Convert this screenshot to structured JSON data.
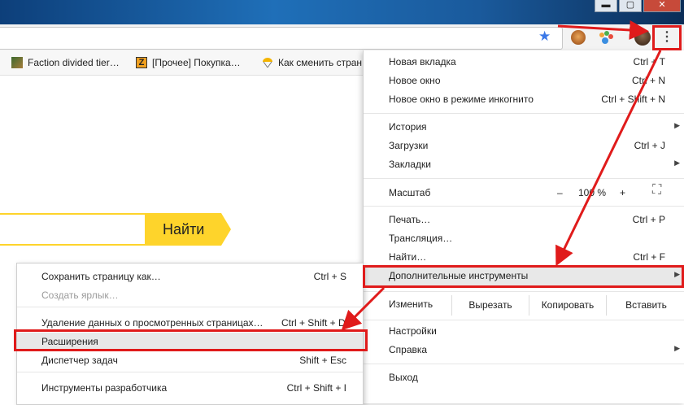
{
  "window": {
    "minimize": "▬",
    "maximize": "▢",
    "close": "✕"
  },
  "toolbar": {
    "bookmark_star": "★",
    "menu_icon": "⋮"
  },
  "bookmarks": [
    {
      "label": "Faction divided tier…"
    },
    {
      "label": "[Прочее] Покупка…",
      "icon_letter": "Z"
    },
    {
      "label": "Как сменить стран"
    }
  ],
  "search": {
    "button_label": "Найти"
  },
  "menu": {
    "new_tab": {
      "label": "Новая вкладка",
      "shortcut": "Ctrl + T"
    },
    "new_window": {
      "label": "Новое окно",
      "shortcut": "Ctrl + N"
    },
    "incognito": {
      "label": "Новое окно в режиме инкогнито",
      "shortcut": "Ctrl + Shift + N"
    },
    "history": {
      "label": "История"
    },
    "downloads": {
      "label": "Загрузки",
      "shortcut": "Ctrl + J"
    },
    "bookmarks": {
      "label": "Закладки"
    },
    "zoom": {
      "label": "Масштаб",
      "minus": "–",
      "value": "100 %",
      "plus": "+",
      "fullscreen": "⛶"
    },
    "print": {
      "label": "Печать…",
      "shortcut": "Ctrl + P"
    },
    "cast": {
      "label": "Трансляция…"
    },
    "find": {
      "label": "Найти…",
      "shortcut": "Ctrl + F"
    },
    "more_tools": {
      "label": "Дополнительные инструменты"
    },
    "edit": {
      "label": "Изменить",
      "cut": "Вырезать",
      "copy": "Копировать",
      "paste": "Вставить"
    },
    "settings": {
      "label": "Настройки"
    },
    "help": {
      "label": "Справка"
    },
    "exit": {
      "label": "Выход"
    },
    "arrow": "▶"
  },
  "submenu": {
    "save_page": {
      "label": "Сохранить страницу как…",
      "shortcut": "Ctrl + S"
    },
    "create_shortcut": {
      "label": "Создать ярлык…"
    },
    "clear_data": {
      "label": "Удаление данных о просмотренных страницах…",
      "shortcut": "Ctrl + Shift + Del"
    },
    "extensions": {
      "label": "Расширения"
    },
    "task_manager": {
      "label": "Диспетчер задач",
      "shortcut": "Shift + Esc"
    },
    "dev_tools": {
      "label": "Инструменты разработчика",
      "shortcut": "Ctrl + Shift + I"
    }
  },
  "colors": {
    "highlight_red": "#e01b1b",
    "yandex_yellow": "#fed42b",
    "star_blue": "#3b78e7"
  }
}
